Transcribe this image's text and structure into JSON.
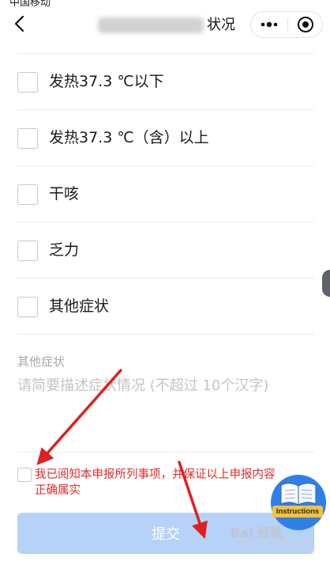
{
  "status_bar": {
    "left": "中国移动",
    "right": "••"
  },
  "header": {
    "title_suffix": "状况"
  },
  "symptom_options": [
    {
      "label": "发热37.3 ℃以下"
    },
    {
      "label": "发热37.3 ℃（含）以上"
    },
    {
      "label": "干咳"
    },
    {
      "label": "乏力"
    },
    {
      "label": "其他症状"
    }
  ],
  "other_symptoms": {
    "label": "其他症状",
    "placeholder": "请简要描述症状情况 (不超过 10个汉字)"
  },
  "agreement": {
    "text": "我已阅知本申报所列事项，并保证以上申报内容正确属实"
  },
  "submit": {
    "label": "提交"
  },
  "instructions_badge": {
    "label": "Instructions"
  },
  "watermark": {
    "text": "Bai 经验",
    "sub": "jingyan.baidu.com"
  },
  "colors": {
    "submit_disabled": "#b6d2f6",
    "agreement_text": "#e02c2c",
    "arrow": "#e02020",
    "badge_blue": "#2f7fe8",
    "badge_yellow": "#f3c23b"
  }
}
